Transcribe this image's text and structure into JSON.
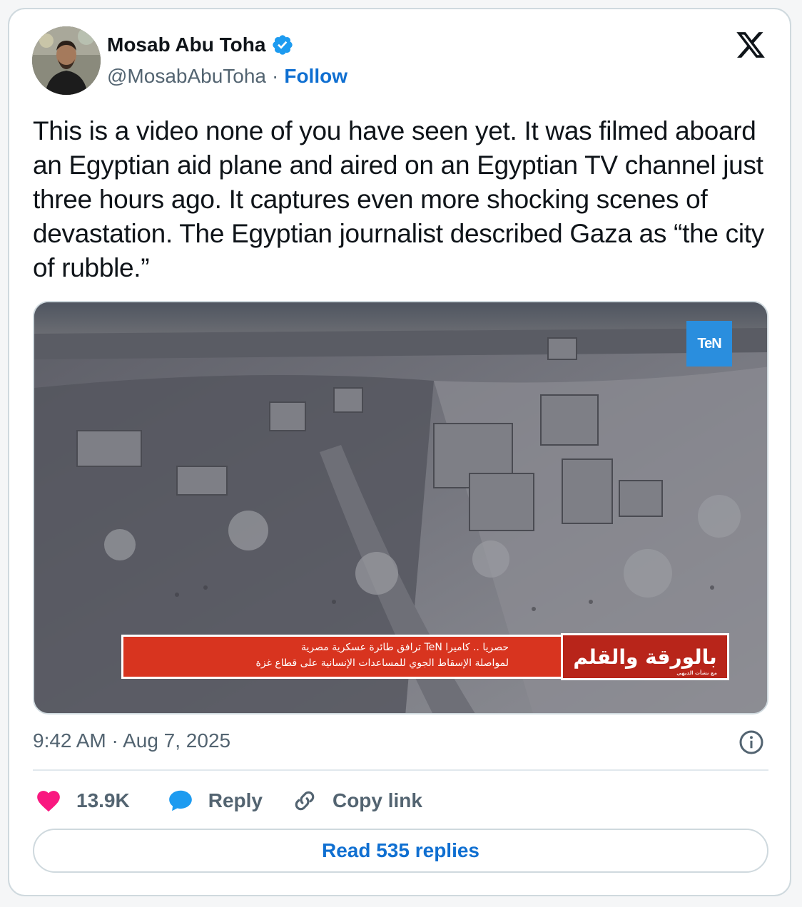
{
  "author": {
    "name": "Mosab Abu Toha",
    "handle": "@MosabAbuToha",
    "separator": "·",
    "follow_label": "Follow"
  },
  "tweet": {
    "text": "This is a video none of you have seen yet. It was filmed aboard an Egyptian aid plane and aired on an Egyptian TV channel just three hours ago. It captures even more shocking scenes of devastation. The Egyptian journalist described Gaza as “the city of rubble.”"
  },
  "video": {
    "channel_logo": "TeN",
    "ticker_line1": "حصريا .. كاميرا TeN ترافق طائرة عسكرية مصرية",
    "ticker_line2": "لمواصلة الإسقاط الجوي للمساعدات الإنسانية على قطاع غزة",
    "program_name": "بالورقة والقلم",
    "program_sub": "مع نشأت الديهي"
  },
  "meta": {
    "timestamp": "9:42 AM · Aug 7, 2025"
  },
  "actions": {
    "likes": "13.9K",
    "reply_label": "Reply",
    "copy_label": "Copy link"
  },
  "replies_button": "Read 535 replies",
  "colors": {
    "like": "#f91880",
    "reply": "#1d9bf0",
    "link": "#0f6fd1",
    "ticker": "#d8341f"
  },
  "icons": [
    "verified-badge-icon",
    "x-logo-icon",
    "info-icon",
    "heart-icon",
    "reply-bubble-icon",
    "link-icon"
  ]
}
